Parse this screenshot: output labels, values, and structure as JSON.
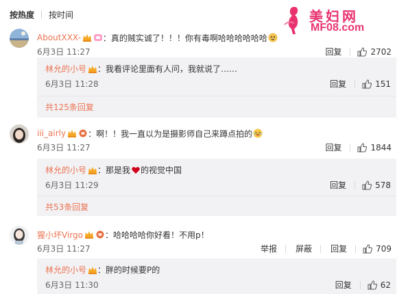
{
  "sort": {
    "hot": "按热度",
    "time": "按时间"
  },
  "logo": {
    "cn": "美妇网",
    "en": "MF08.com"
  },
  "comments": [
    {
      "user": "AboutXXX-",
      "text": "：真的贼实诚了！！！你有毒啊哈哈哈哈哈哈",
      "date": "6月3日 11:27",
      "reply_label": "回复",
      "likes": "2702",
      "reply": {
        "user": "林允的小号",
        "text": "：我看评论里面有人问，我就说了……",
        "date": "6月3日 11:28",
        "reply_label": "回复",
        "likes": "151",
        "more": "共125条回复"
      }
    },
    {
      "user": "iii_airly",
      "text": "：啊！！我一直以为是摄影师自己来蹲点拍的",
      "date": "6月3日 11:27",
      "reply_label": "回复",
      "likes": "1844",
      "reply": {
        "user": "林允的小号",
        "text_before": "：那是我",
        "text_after": "的视觉中国",
        "date": "6月3日 11:29",
        "reply_label": "回复",
        "likes": "578",
        "more": "共53条回复"
      }
    },
    {
      "user": "猩小坏Virgo",
      "text": "：哈哈哈哈你好看！不用p！",
      "date": "6月3日 11:27",
      "report_label": "举报",
      "block_label": "屏蔽",
      "reply_label": "回复",
      "likes": "709",
      "reply": {
        "user": "林允的小号",
        "text": "：胖的时候要P的",
        "date": "6月3日 11:30",
        "reply_label": "回复",
        "likes": "62"
      }
    }
  ]
}
